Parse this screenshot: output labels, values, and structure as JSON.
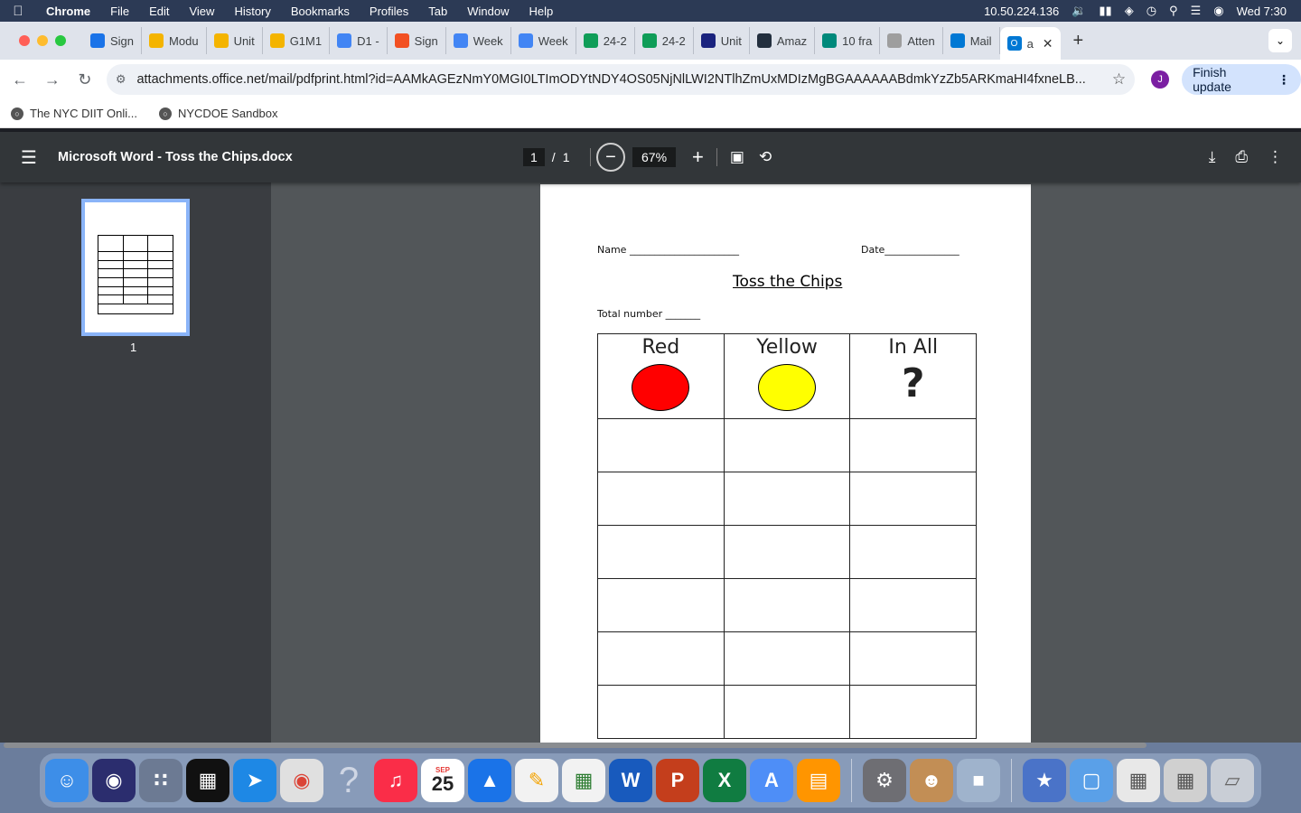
{
  "menubar": {
    "app": "Chrome",
    "items": [
      "File",
      "Edit",
      "View",
      "History",
      "Bookmarks",
      "Profiles",
      "Tab",
      "Window",
      "Help"
    ],
    "ip": "10.50.224.136",
    "clock": "Wed 7:30"
  },
  "tabs": [
    {
      "label": "Sign",
      "color": "#1a73e8"
    },
    {
      "label": "Modu",
      "color": "#f4b400"
    },
    {
      "label": "Unit",
      "color": "#f4b400"
    },
    {
      "label": "G1M1",
      "color": "#f4b400"
    },
    {
      "label": "D1 -",
      "color": "#4285f4"
    },
    {
      "label": "Sign",
      "color": "#f25022"
    },
    {
      "label": "Week",
      "color": "#4285f4"
    },
    {
      "label": "Week",
      "color": "#4285f4"
    },
    {
      "label": "24-2",
      "color": "#0f9d58"
    },
    {
      "label": "24-2",
      "color": "#0f9d58"
    },
    {
      "label": "Unit",
      "color": "#1a237e"
    },
    {
      "label": "Amaz",
      "color": "#232f3e"
    },
    {
      "label": "10 fra",
      "color": "#00897b"
    },
    {
      "label": "Atten",
      "color": "#9e9e9e"
    },
    {
      "label": "Mail",
      "color": "#0078d4"
    }
  ],
  "active_tab": {
    "label": "a",
    "color": "#0078d4"
  },
  "toolbar": {
    "url": "attachments.office.net/mail/pdfprint.html?id=AAMkAGEzNmY0MGI0LTImODYtNDY4OS05NjNlLWI2NTlhZmUxMDIzMgBGAAAAAABdmkYzZb5ARKmaHI4fxneLB...",
    "profile_initial": "J",
    "finish_update": "Finish update"
  },
  "bookmarks": [
    "The NYC DIIT Onli...",
    "NYCDOE Sandbox"
  ],
  "pdf": {
    "title": "Microsoft Word - Toss the Chips.docx",
    "page_current": "1",
    "page_sep": "/",
    "page_total": "1",
    "zoom": "67%",
    "thumb_number": "1"
  },
  "document": {
    "name_label": "Name ______________________",
    "date_label": "Date_______________",
    "title": "Toss the Chips",
    "total_label": "Total number _______",
    "col_red": "Red",
    "col_yellow": "Yellow",
    "col_inall": "In All",
    "question": "?"
  },
  "dock_calendar": {
    "month": "SEP",
    "day": "25"
  }
}
